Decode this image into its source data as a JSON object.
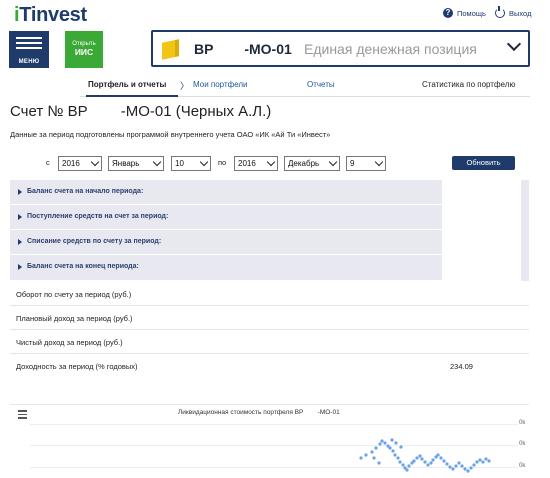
{
  "header": {
    "logo_prefix": "i",
    "logo_rest": "Tinvest",
    "help_label": "Помощь",
    "logout_label": "Выход",
    "menu_label": "МЕНЮ",
    "iis_line1": "Открыть",
    "iis_line2": "ИИС",
    "account_code": "BP        -MO-01",
    "account_desc": "Единая денежная позиция"
  },
  "tabs": {
    "active": "Портфель и отчеты",
    "separator": "〉",
    "my_portfolios": "Мои портфели",
    "reports": "Отчеты",
    "stats": "Статистика по портфелю"
  },
  "page": {
    "title": "Счет № BP        -MO-01 (Черных А.Л.)",
    "subtitle": "Данные за период подготовлены программой внутреннего учета ОАО «ИК «Ай Ти «Инвест»"
  },
  "filter": {
    "from_label": "с",
    "from_year": "2016",
    "from_month": "Январь",
    "from_day": "10",
    "to_label": "по",
    "to_year": "2016",
    "to_month": "Декабрь",
    "to_day": "9",
    "refresh_label": "Обновить"
  },
  "sections": [
    "Баланс счета на начало периода:",
    "Поступление средств на счет за период:",
    "Списание средств по счету за период:",
    "Баланс счета на конец периода:"
  ],
  "rows": [
    {
      "label": "Оборот по счету за период (руб.)",
      "value": ""
    },
    {
      "label": "Плановый доход за период (руб.)",
      "value": ""
    },
    {
      "label": "Чистый доход за период (руб.)",
      "value": ""
    },
    {
      "label": "Доходность за период (% годовых)",
      "value": "234.09"
    }
  ],
  "chart": {
    "title": "Ликвидационная стоимость портфеля BP        -MO-01",
    "y_ticks": [
      "0k",
      "0k",
      "0k"
    ],
    "point_color": "#6aa3e8"
  },
  "colors": {
    "brand": "#1e3b6b",
    "accent_green": "#3aa935",
    "section_bg": "#e8e8f0"
  }
}
